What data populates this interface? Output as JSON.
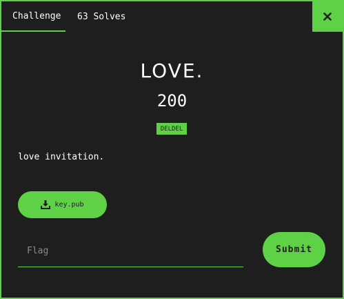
{
  "tabs": {
    "challenge_label": "Challenge",
    "solves_label": "63 Solves"
  },
  "close_label": "×",
  "challenge": {
    "title": "LOVE.",
    "points": "200",
    "tag": "DELDEL",
    "description": "love invitation."
  },
  "file": {
    "name": "key.pub",
    "icon": "download-icon"
  },
  "flag_form": {
    "placeholder": "Flag",
    "value": "",
    "submit_label": "Submit"
  },
  "colors": {
    "accent": "#5fd147",
    "background": "#1e1e1e",
    "text": "#ffffff"
  }
}
